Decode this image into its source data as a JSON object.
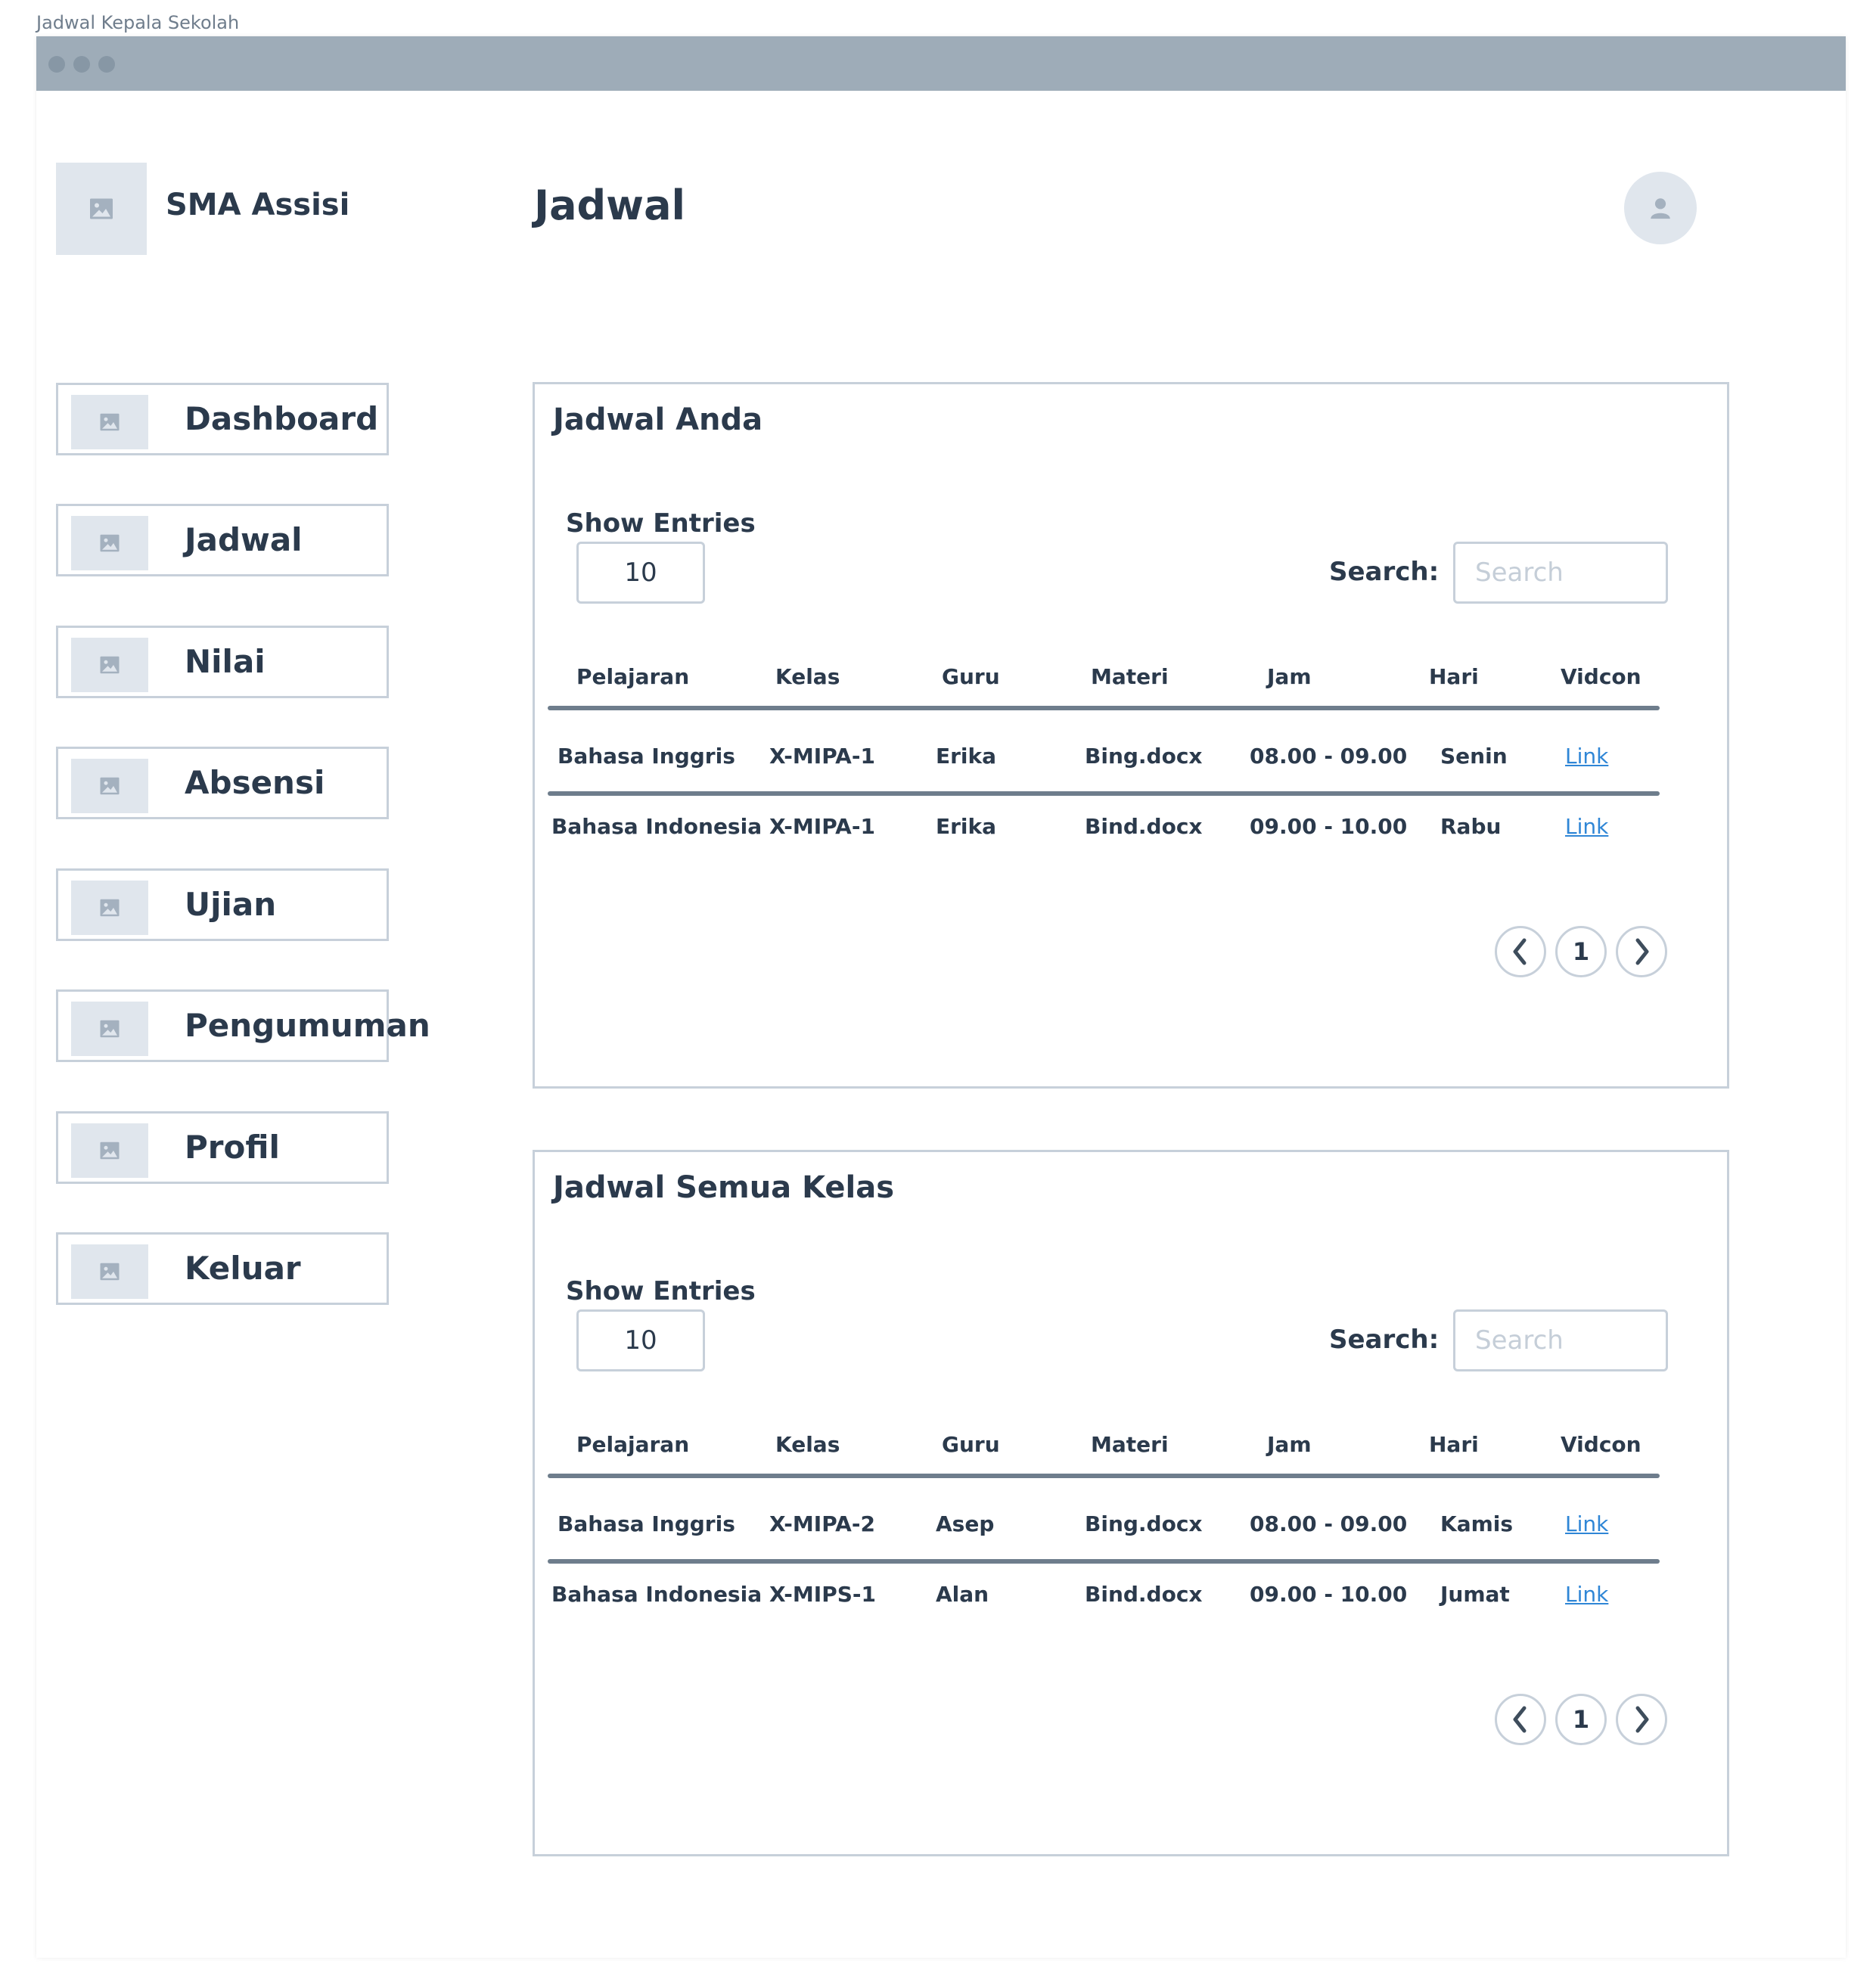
{
  "frame_caption": "Jadwal Kepala Sekolah",
  "brand": {
    "name": "SMA Assisi",
    "logo_icon": "image-placeholder-icon"
  },
  "header": {
    "title": "Jadwal",
    "avatar_icon": "user-icon"
  },
  "sidebar": {
    "items": [
      {
        "label": "Dashboard"
      },
      {
        "label": "Jadwal"
      },
      {
        "label": "Nilai"
      },
      {
        "label": "Absensi"
      },
      {
        "label": "Ujian"
      },
      {
        "label": "Pengumuman"
      },
      {
        "label": "Profil"
      },
      {
        "label": "Keluar"
      }
    ]
  },
  "columns": [
    "Pelajaran",
    "Kelas",
    "Guru",
    "Materi",
    "Jam",
    "Hari",
    "Vidcon"
  ],
  "cards": [
    {
      "title": "Jadwal Anda",
      "show_entries_label": "Show Entries",
      "entries_value": "10",
      "search_label": "Search:",
      "search_placeholder": "Search",
      "rows": [
        {
          "pelajaran": "Bahasa Inggris",
          "kelas": "X-MIPA-1",
          "guru": "Erika",
          "materi": "Bing.docx",
          "jam": "08.00 - 09.00",
          "hari": "Senin",
          "vidcon": "Link"
        },
        {
          "pelajaran": "Bahasa Indonesia",
          "kelas": "X-MIPA-1",
          "guru": "Erika",
          "materi": "Bind.docx",
          "jam": "09.00 - 10.00",
          "hari": "Rabu",
          "vidcon": "Link"
        }
      ],
      "pagination": {
        "current_page": "1"
      }
    },
    {
      "title": "Jadwal Semua Kelas",
      "show_entries_label": "Show Entries",
      "entries_value": "10",
      "search_label": "Search:",
      "search_placeholder": "Search",
      "rows": [
        {
          "pelajaran": "Bahasa Inggris",
          "kelas": "X-MIPA-2",
          "guru": "Asep",
          "materi": "Bing.docx",
          "jam": "08.00 - 09.00",
          "hari": "Kamis",
          "vidcon": "Link"
        },
        {
          "pelajaran": "Bahasa Indonesia",
          "kelas": "X-MIPS-1",
          "guru": "Alan",
          "materi": "Bind.docx",
          "jam": "09.00 - 10.00",
          "hari": "Jumat",
          "vidcon": "Link"
        }
      ],
      "pagination": {
        "current_page": "1"
      }
    }
  ],
  "colors": {
    "titlebar": "#9eacb8",
    "text": "#2b3a4c",
    "border": "#c7d0da",
    "placeholder_fill": "#e0e6ed",
    "link": "#2f86d6",
    "table_rule": "#6e7d8c"
  }
}
